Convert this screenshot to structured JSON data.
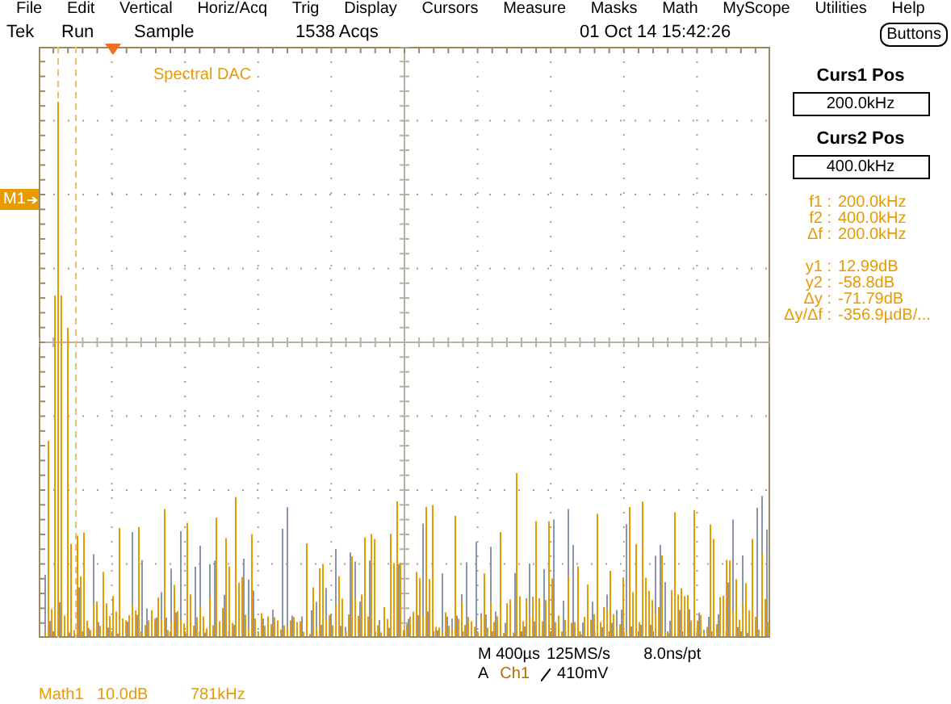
{
  "menu": [
    "File",
    "Edit",
    "Vertical",
    "Horiz/Acq",
    "Trig",
    "Display",
    "Cursors",
    "Measure",
    "Masks",
    "Math",
    "MyScope",
    "Utilities",
    "Help"
  ],
  "status": {
    "brand": "Tek",
    "run": "Run",
    "mode": "Sample",
    "acqs": "1538 Acqs",
    "datetime": "01 Oct 14 15:42:26"
  },
  "buttons_label": "Buttons",
  "trace_label": "Spectral DAC",
  "marker": "M1",
  "cursors": [
    {
      "label": "Curs1 Pos",
      "value": "200.0kHz"
    },
    {
      "label": "Curs2 Pos",
      "value": "400.0kHz"
    }
  ],
  "readouts": [
    [
      {
        "label": "f1 :",
        "value": "200.0kHz"
      },
      {
        "label": "f2 :",
        "value": "400.0kHz"
      },
      {
        "label": "Δf :",
        "value": "200.0kHz"
      }
    ],
    [
      {
        "label": "y1 :",
        "value": "12.99dB"
      },
      {
        "label": "y2 :",
        "value": "-58.8dB"
      },
      {
        "label": "Δy :",
        "value": "-71.79dB"
      },
      {
        "label": "Δy/Δf :",
        "value": "-356.9µdB/..."
      }
    ]
  ],
  "horizontal": {
    "scale": "M 400µs",
    "rate": "125MS/s",
    "resolution": "8.0ns/pt"
  },
  "trigger": {
    "mode": "A",
    "source": "Ch1",
    "level": "410mV"
  },
  "math": {
    "name": "Math1",
    "scale": "10.0dB",
    "span": "781kHz"
  }
}
